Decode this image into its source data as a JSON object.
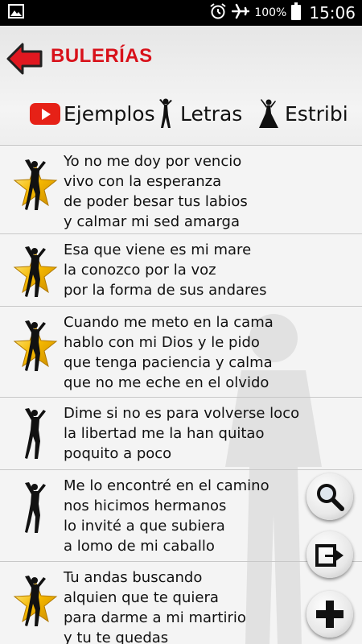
{
  "status_bar": {
    "battery_percent": "100%",
    "time": "15:06",
    "icons": [
      "image-icon",
      "alarm-icon",
      "airplane-icon",
      "battery-icon"
    ]
  },
  "header": {
    "title": "BULERÍAS",
    "title_color": "#d8111a",
    "tabs": [
      {
        "label": "Ejemplos",
        "icon": "youtube-icon"
      },
      {
        "label": "Letras",
        "icon": "dancer-icon"
      },
      {
        "label": "Estribi",
        "icon": "flamenco-dancer-icon"
      }
    ]
  },
  "lyrics": [
    {
      "favorite": true,
      "lines": [
        "Yo no me doy por vencio",
        "vivo con la esperanza",
        "de poder besar tus labios",
        "y calmar mi sed amarga"
      ]
    },
    {
      "favorite": true,
      "lines": [
        "Esa que viene es mi mare",
        "la conozco por la voz",
        "por la forma de sus andares"
      ]
    },
    {
      "favorite": true,
      "lines": [
        "Cuando me meto en la cama",
        "hablo con mi Dios y le pido",
        "que tenga paciencia y calma",
        "que no me eche en el olvido"
      ]
    },
    {
      "favorite": false,
      "lines": [
        "Dime si no es para volverse loco",
        "la libertad me la han quitao",
        "poquito a poco"
      ]
    },
    {
      "favorite": false,
      "lines": [
        "Me lo encontré en el camino",
        "nos hicimos hermanos",
        "lo invité a que subiera",
        "a lomo de mi caballo"
      ]
    },
    {
      "favorite": true,
      "lines": [
        "Tu andas buscando",
        "alquien que te quiera",
        "para darme a mi martirio",
        "y tu te quedas"
      ]
    }
  ],
  "actions": [
    "search-icon",
    "share-icon",
    "add-icon"
  ],
  "colors": {
    "accent_red": "#d8111a",
    "star_gold": "#f5b800",
    "youtube_red": "#e62117"
  }
}
